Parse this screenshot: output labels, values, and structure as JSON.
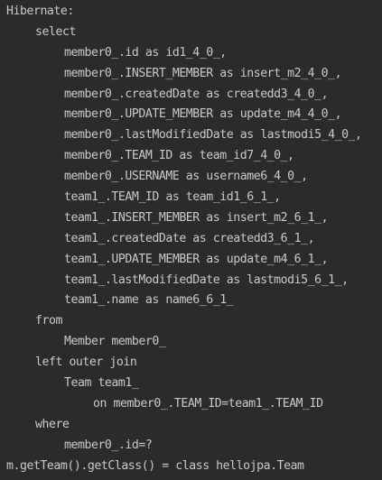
{
  "console": {
    "header": "Hibernate:",
    "lines": [
      "select",
      "member0_.id as id1_4_0_,",
      "member0_.INSERT_MEMBER as insert_m2_4_0_,",
      "member0_.createdDate as createdd3_4_0_,",
      "member0_.UPDATE_MEMBER as update_m4_4_0_,",
      "member0_.lastModifiedDate as lastmodi5_4_0_,",
      "member0_.TEAM_ID as team_id7_4_0_,",
      "member0_.USERNAME as username6_4_0_,",
      "team1_.TEAM_ID as team_id1_6_1_,",
      "team1_.INSERT_MEMBER as insert_m2_6_1_,",
      "team1_.createdDate as createdd3_6_1_,",
      "team1_.UPDATE_MEMBER as update_m4_6_1_,",
      "team1_.lastModifiedDate as lastmodi5_6_1_,",
      "team1_.name as name6_6_1_",
      "from",
      "Member member0_",
      "left outer join",
      "Team team1_",
      "on member0_.TEAM_ID=team1_.TEAM_ID",
      "where",
      "member0_.id=?"
    ],
    "output": "m.getTeam().getClass() = class hellojpa.Team"
  },
  "colors": {
    "background": "#2b2b2b",
    "text": "#c9c9c9"
  }
}
